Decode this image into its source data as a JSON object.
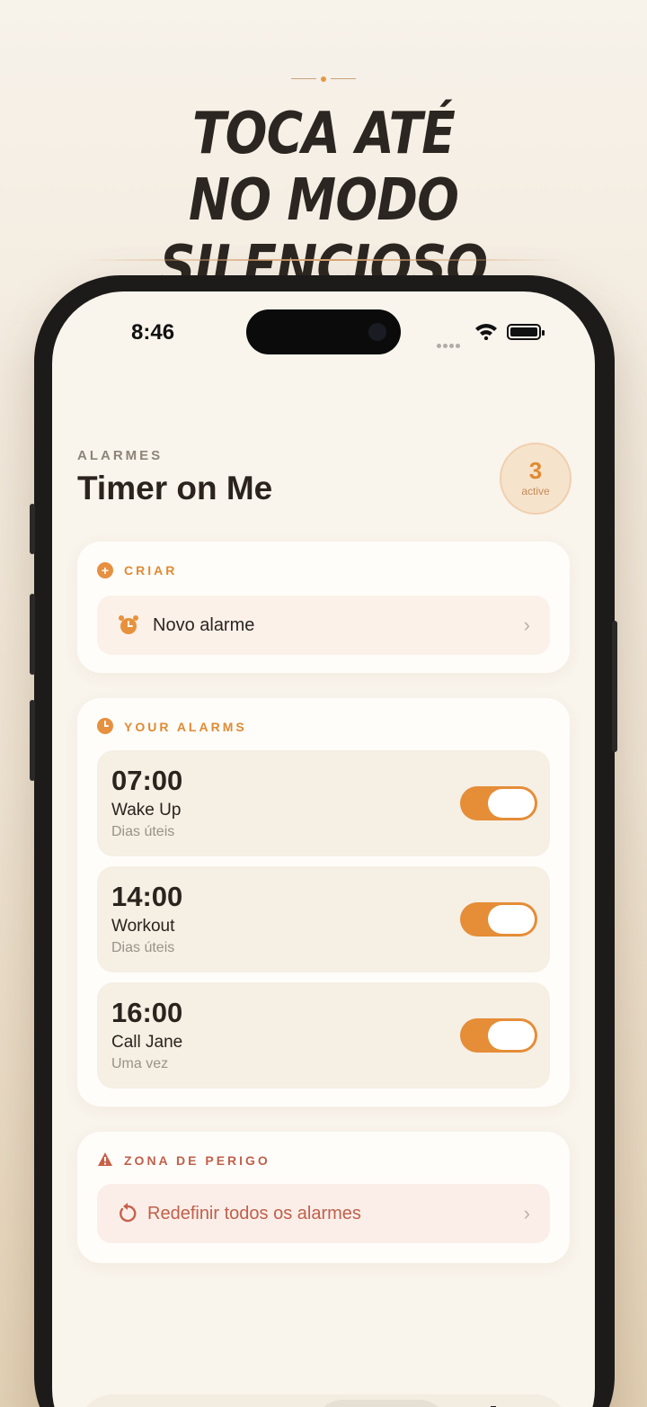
{
  "headline": {
    "line1": "TOCA ATÉ",
    "line2": "NO MODO SILENCIOSO"
  },
  "status_bar": {
    "time": "8:46"
  },
  "header": {
    "eyebrow": "ALARMES",
    "title": "Timer on Me",
    "active_count": "3",
    "active_label": "active"
  },
  "create_section": {
    "label": "CRIAR",
    "new_alarm_label": "Novo alarme"
  },
  "alarms_section": {
    "label": "YOUR ALARMS",
    "items": [
      {
        "time": "07:00",
        "name": "Wake Up",
        "repeat": "Dias úteis",
        "enabled": true
      },
      {
        "time": "14:00",
        "name": "Workout",
        "repeat": "Dias úteis",
        "enabled": true
      },
      {
        "time": "16:00",
        "name": "Call Jane",
        "repeat": "Uma vez",
        "enabled": true
      }
    ]
  },
  "danger_section": {
    "label": "ZONA DE PERIGO",
    "reset_label": "Redefinir todos os alarmes"
  },
  "tabs": [
    {
      "icon": "stopwatch-icon",
      "active": false
    },
    {
      "icon": "timer-icon",
      "active": false
    },
    {
      "icon": "alarm-clock-icon",
      "active": true
    },
    {
      "icon": "gear-icon",
      "active": false
    }
  ],
  "colors": {
    "accent": "#e58d37",
    "danger": "#c0604a",
    "background": "#f9f4ec"
  }
}
